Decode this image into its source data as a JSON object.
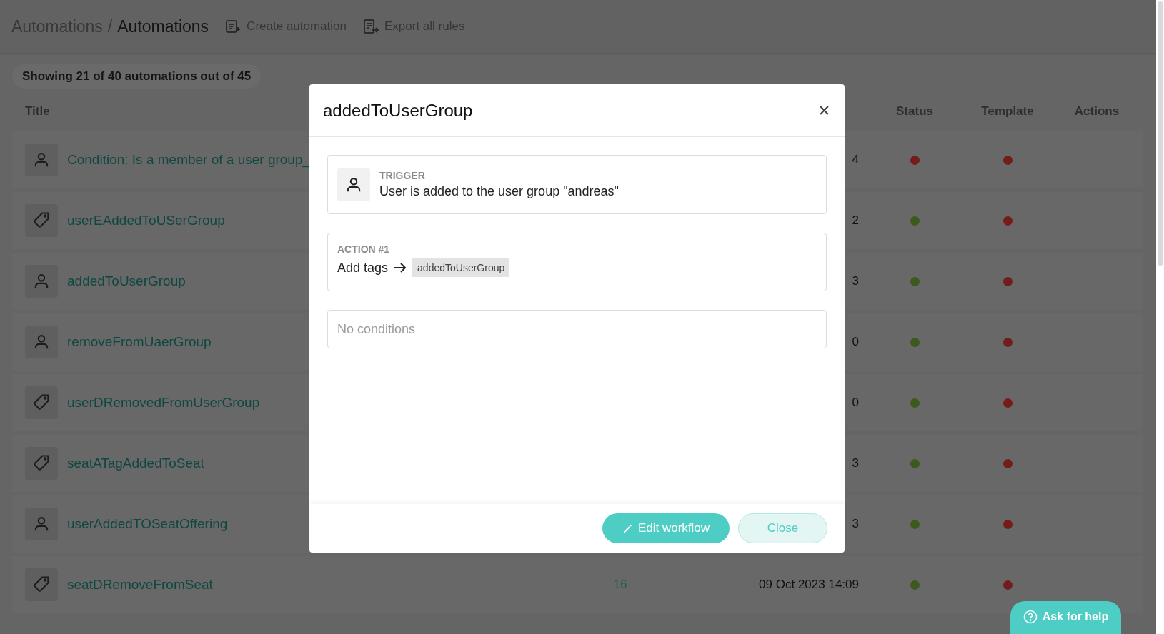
{
  "header": {
    "breadcrumb_parent": "Automations",
    "breadcrumb_separator": "/",
    "breadcrumb_current": "Automations",
    "actions": [
      {
        "label": "Create automation",
        "kind": "create"
      },
      {
        "label": "Export all rules",
        "kind": "export"
      }
    ]
  },
  "summary": "Showing 21 of 40 automations out of 45",
  "table": {
    "columns": [
      {
        "label": "Title",
        "kind": "title"
      },
      {
        "label": "Status",
        "kind": "status"
      },
      {
        "label": "Template",
        "kind": "template"
      },
      {
        "label": "Actions",
        "kind": "actions"
      }
    ],
    "rows": [
      {
        "kind": "user",
        "title": "Condition: Is a member of a user group_",
        "date": "4",
        "active": false,
        "template": false
      },
      {
        "kind": "tag",
        "title": "userEAddedToUSerGroup",
        "date": "2",
        "active": true,
        "template": false
      },
      {
        "kind": "user",
        "title": "addedToUserGroup",
        "date": "3",
        "active": true,
        "template": false
      },
      {
        "kind": "user",
        "title": "removeFromUaerGroup",
        "date": "0",
        "active": true,
        "template": false
      },
      {
        "kind": "tag",
        "title": "userDRemovedFromUserGroup",
        "date": "0",
        "active": true,
        "template": false
      },
      {
        "kind": "tag",
        "title": "seatATagAddedToSeat",
        "date": "3",
        "active": true,
        "template": false
      },
      {
        "kind": "user",
        "title": "userAddedTOSeatOffering",
        "date": "3",
        "active": true,
        "template": false
      },
      {
        "kind": "tag",
        "title": "seatDRemoveFromSeat",
        "runs": "16",
        "date": "09 Oct 2023 14:09",
        "active": true,
        "template": false
      }
    ]
  },
  "modal": {
    "title": "addedToUserGroup",
    "trigger": {
      "kind": "user",
      "label": "TRIGGER",
      "text": "User is added to the user group \"andreas\""
    },
    "actions": [
      {
        "label": "ACTION #1",
        "verb": "Add tags",
        "tags": [
          "addedToUserGroup"
        ]
      }
    ],
    "conditions_placeholder": "No conditions",
    "buttons": [
      {
        "label": "Edit workflow",
        "kind": "primary"
      },
      {
        "label": "Close",
        "kind": "secondary"
      }
    ]
  },
  "help_button": "Ask for help"
}
